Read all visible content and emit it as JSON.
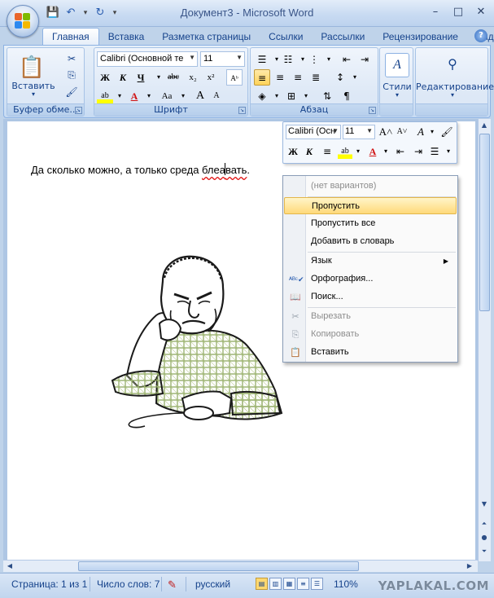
{
  "window": {
    "title": "Документ3 - Microsoft Word",
    "controls": [
      "–",
      "□",
      "✕"
    ]
  },
  "quick_access": {
    "save_icon": "save-icon",
    "undo_icon": "undo-icon",
    "redo_icon": "repeat-icon"
  },
  "tabs": [
    {
      "label": "Главная",
      "active": true
    },
    {
      "label": "Вставка"
    },
    {
      "label": "Разметка страницы"
    },
    {
      "label": "Ссылки"
    },
    {
      "label": "Рассылки"
    },
    {
      "label": "Рецензирование"
    },
    {
      "label": "Вид"
    }
  ],
  "ribbon": {
    "clipboard": {
      "label": "Буфер обме...",
      "paste": "Вставить"
    },
    "font": {
      "label": "Шрифт",
      "name": "Calibri (Основной те",
      "size": "11",
      "bold": "Ж",
      "italic": "К",
      "underline": "Ч",
      "strike": "abc",
      "subscript": "x₂",
      "superscript": "x²",
      "grow": "A",
      "shrink": "A",
      "case": "Aa",
      "highlight": "ab",
      "color": "A"
    },
    "paragraph": {
      "label": "Абзац"
    },
    "styles": {
      "label": "Стили"
    },
    "editing": {
      "label": "Редактирование"
    }
  },
  "document": {
    "text_before": "Да сколько можно, а только среда ",
    "misspelled_word_1": "блеа",
    "misspelled_word_2": "вать",
    "text_after": "."
  },
  "mini_toolbar": {
    "font_name": "Calibri (Осн",
    "font_size": "11",
    "bold": "Ж",
    "italic": "К"
  },
  "context_menu": {
    "items": [
      {
        "label": "(нет вариантов)",
        "disabled": true
      },
      {
        "label": "Пропустить",
        "highlighted": true
      },
      {
        "label": "Пропустить все"
      },
      {
        "label": "Добавить в словарь"
      },
      {
        "label": "Язык",
        "submenu": true
      },
      {
        "label": "Орфография...",
        "icon": "spellcheck-icon"
      },
      {
        "label": "Поиск...",
        "icon": "research-icon"
      },
      {
        "label": "Вырезать",
        "disabled": true,
        "icon": "cut-icon"
      },
      {
        "label": "Копировать",
        "disabled": true,
        "icon": "copy-icon"
      },
      {
        "label": "Вставить",
        "icon": "paste-icon"
      }
    ]
  },
  "status_bar": {
    "page": "Страница: 1 из 1",
    "words": "Число слов: 7",
    "language": "русский",
    "zoom": "110%"
  },
  "watermark": "YAPLAKAL.COM",
  "colors": {
    "ribbon_blue": "#15428b",
    "highlight": "#ffd97a",
    "misspell_underline": "#e01010"
  }
}
